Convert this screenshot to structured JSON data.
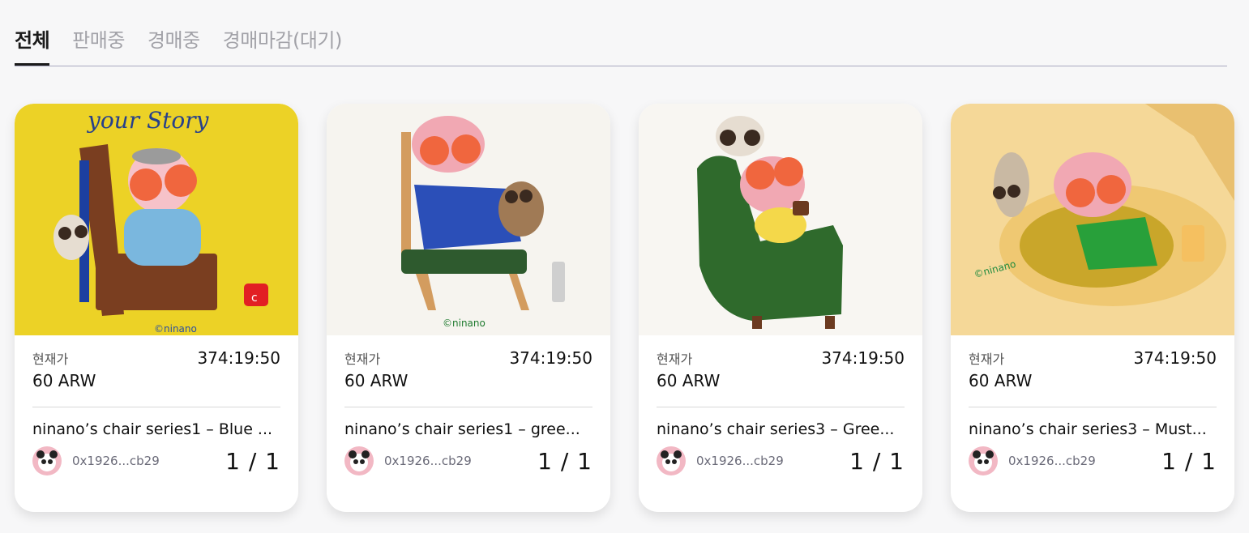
{
  "tabs": [
    {
      "label": "전체",
      "active": true
    },
    {
      "label": "판매중",
      "active": false
    },
    {
      "label": "경매중",
      "active": false
    },
    {
      "label": "경매마감(대기)",
      "active": false
    }
  ],
  "cards": [
    {
      "price_label": "현재가",
      "time_left": "374:19:50",
      "price": "60 ARW",
      "title": "ninano’s chair series1 – Blue ...",
      "owner": "0x1926...cb29",
      "edition": "1 / 1",
      "art_text_top": "your Story",
      "art_signature": "©ninano",
      "accent": "#ecd226"
    },
    {
      "price_label": "현재가",
      "time_left": "374:19:50",
      "price": "60 ARW",
      "title": "ninano’s chair series1 – gree...",
      "owner": "0x1926...cb29",
      "edition": "1 / 1",
      "art_signature": "©ninano",
      "accent": "#f6f4ef"
    },
    {
      "price_label": "현재가",
      "time_left": "374:19:50",
      "price": "60 ARW",
      "title": "ninano’s chair series3 – Gree...",
      "owner": "0x1926...cb29",
      "edition": "1 / 1",
      "accent": "#f8f6f2"
    },
    {
      "price_label": "현재가",
      "time_left": "374:19:50",
      "price": "60 ARW",
      "title": "ninano’s chair series3 – Must...",
      "owner": "0x1926...cb29",
      "edition": "1 / 1",
      "art_signature": "©ninano",
      "accent": "#f5d898"
    }
  ]
}
